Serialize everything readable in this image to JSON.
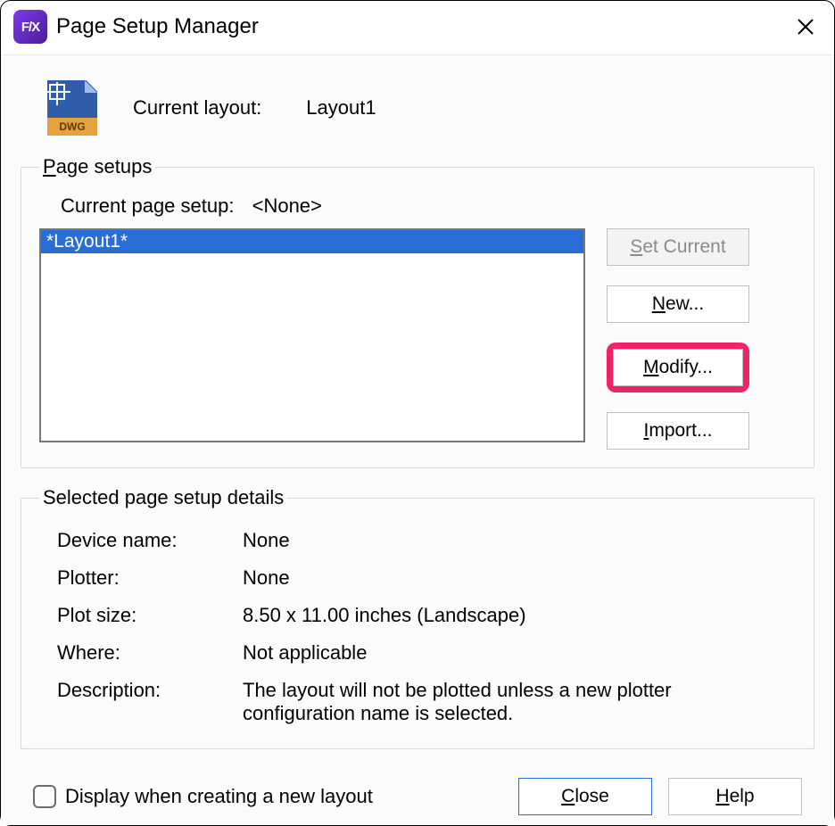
{
  "window": {
    "title": "Page Setup Manager",
    "app_icon_text": "F/X"
  },
  "header": {
    "dwg_label": "DWG",
    "current_layout_label": "Current layout:",
    "current_layout_value": "Layout1"
  },
  "page_setups": {
    "legend_prefix": "P",
    "legend_rest": "age setups",
    "current_label": "Current page setup:",
    "current_value": "<None>",
    "items": [
      "*Layout1*"
    ],
    "buttons": {
      "set_current_prefix": "S",
      "set_current_rest": "et Current",
      "new_prefix": "N",
      "new_rest": "ew...",
      "modify_prefix": "M",
      "modify_rest": "odify...",
      "import_prefix": "I",
      "import_rest": "mport..."
    }
  },
  "details": {
    "legend": "Selected page setup details",
    "rows": {
      "device_name_label": "Device name:",
      "device_name_value": "None",
      "plotter_label": "Plotter:",
      "plotter_value": "None",
      "plot_size_label": "Plot size:",
      "plot_size_value": "8.50 x 11.00 inches (Landscape)",
      "where_label": "Where:",
      "where_value": "Not applicable",
      "description_label": "Description:",
      "description_value": "The layout will not be plotted unless a new plotter configuration name is selected."
    }
  },
  "footer": {
    "display_checkbox_prefix": "D",
    "display_checkbox_rest": "isplay when creating a new layout",
    "close_prefix": "C",
    "close_rest": "lose",
    "help_prefix": "H",
    "help_rest": "elp"
  }
}
